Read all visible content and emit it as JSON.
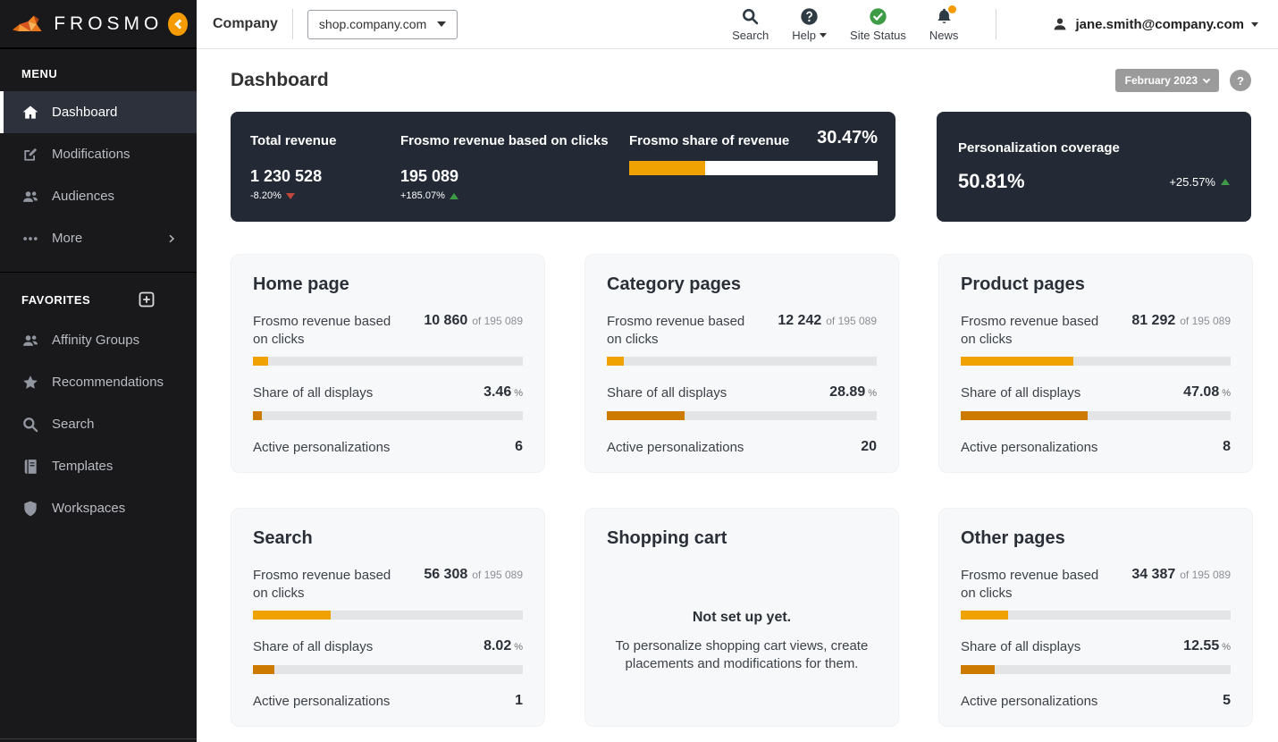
{
  "brand": {
    "name": "FROSMO"
  },
  "topbar": {
    "company_label": "Company",
    "site_selector_value": "shop.company.com",
    "actions": [
      {
        "label": "Search"
      },
      {
        "label": "Help"
      },
      {
        "label": "Site Status"
      },
      {
        "label": "News"
      }
    ],
    "user_email": "jane.smith@company.com"
  },
  "sidebar": {
    "menu_header": "MENU",
    "menu_items": [
      {
        "label": "Dashboard"
      },
      {
        "label": "Modifications"
      },
      {
        "label": "Audiences"
      },
      {
        "label": "More"
      }
    ],
    "favorites_header": "FAVORITES",
    "favorites_items": [
      {
        "label": "Affinity Groups"
      },
      {
        "label": "Recommendations"
      },
      {
        "label": "Search"
      },
      {
        "label": "Templates"
      },
      {
        "label": "Workspaces"
      }
    ]
  },
  "page": {
    "title": "Dashboard",
    "period_label": "February 2023",
    "help_glyph": "?"
  },
  "summary": {
    "total_revenue": {
      "label": "Total revenue",
      "value": "1 230 528",
      "delta": "-8.20%",
      "trend": "down"
    },
    "frosmo_revenue": {
      "label": "Frosmo revenue based on clicks",
      "value": "195 089",
      "delta": "+185.07%",
      "trend": "up"
    },
    "share_of_revenue": {
      "label": "Frosmo share of revenue",
      "value": "30.47%",
      "bar_percent": 30.47
    },
    "coverage": {
      "label": "Personalization coverage",
      "value": "50.81%",
      "delta": "+25.57%",
      "trend": "up"
    }
  },
  "cards": [
    {
      "title": "Home page",
      "revenue_label": "Frosmo revenue based on clicks",
      "revenue_value": "10 860",
      "of_word": "of",
      "revenue_total": "195 089",
      "revenue_percent": 5.57,
      "share_label": "Share of all displays",
      "share_value": "3.46",
      "share_unit": "%",
      "share_percent": 3.46,
      "active_label": "Active personalizations",
      "active_value": "6"
    },
    {
      "title": "Category pages",
      "revenue_label": "Frosmo revenue based on clicks",
      "revenue_value": "12 242",
      "of_word": "of",
      "revenue_total": "195 089",
      "revenue_percent": 6.27,
      "share_label": "Share of all displays",
      "share_value": "28.89",
      "share_unit": "%",
      "share_percent": 28.89,
      "active_label": "Active personalizations",
      "active_value": "20"
    },
    {
      "title": "Product pages",
      "revenue_label": "Frosmo revenue based on clicks",
      "revenue_value": "81 292",
      "of_word": "of",
      "revenue_total": "195 089",
      "revenue_percent": 41.67,
      "share_label": "Share of all displays",
      "share_value": "47.08",
      "share_unit": "%",
      "share_percent": 47.08,
      "active_label": "Active personalizations",
      "active_value": "8"
    },
    {
      "title": "Search",
      "revenue_label": "Frosmo revenue based on clicks",
      "revenue_value": "56 308",
      "of_word": "of",
      "revenue_total": "195 089",
      "revenue_percent": 28.86,
      "share_label": "Share of all displays",
      "share_value": "8.02",
      "share_unit": "%",
      "share_percent": 8.02,
      "active_label": "Active personalizations",
      "active_value": "1"
    },
    {
      "title": "Shopping cart",
      "empty_title": "Not set up yet.",
      "empty_text": "To personalize shopping cart views, create placements and modifications for them."
    },
    {
      "title": "Other pages",
      "revenue_label": "Frosmo revenue based on clicks",
      "revenue_value": "34 387",
      "of_word": "of",
      "revenue_total": "195 089",
      "revenue_percent": 17.63,
      "share_label": "Share of all displays",
      "share_value": "12.55",
      "share_unit": "%",
      "share_percent": 12.55,
      "active_label": "Active personalizations",
      "active_value": "5"
    }
  ],
  "colors": {
    "brand_orange": "#f59b00",
    "bar_amber": "#f0a202",
    "bar_dark_orange": "#cd7b00",
    "dark_card_bg": "#232a35",
    "positive_green": "#3f9c46",
    "negative_red": "#c0453a",
    "sidebar_bg": "#19191b"
  }
}
